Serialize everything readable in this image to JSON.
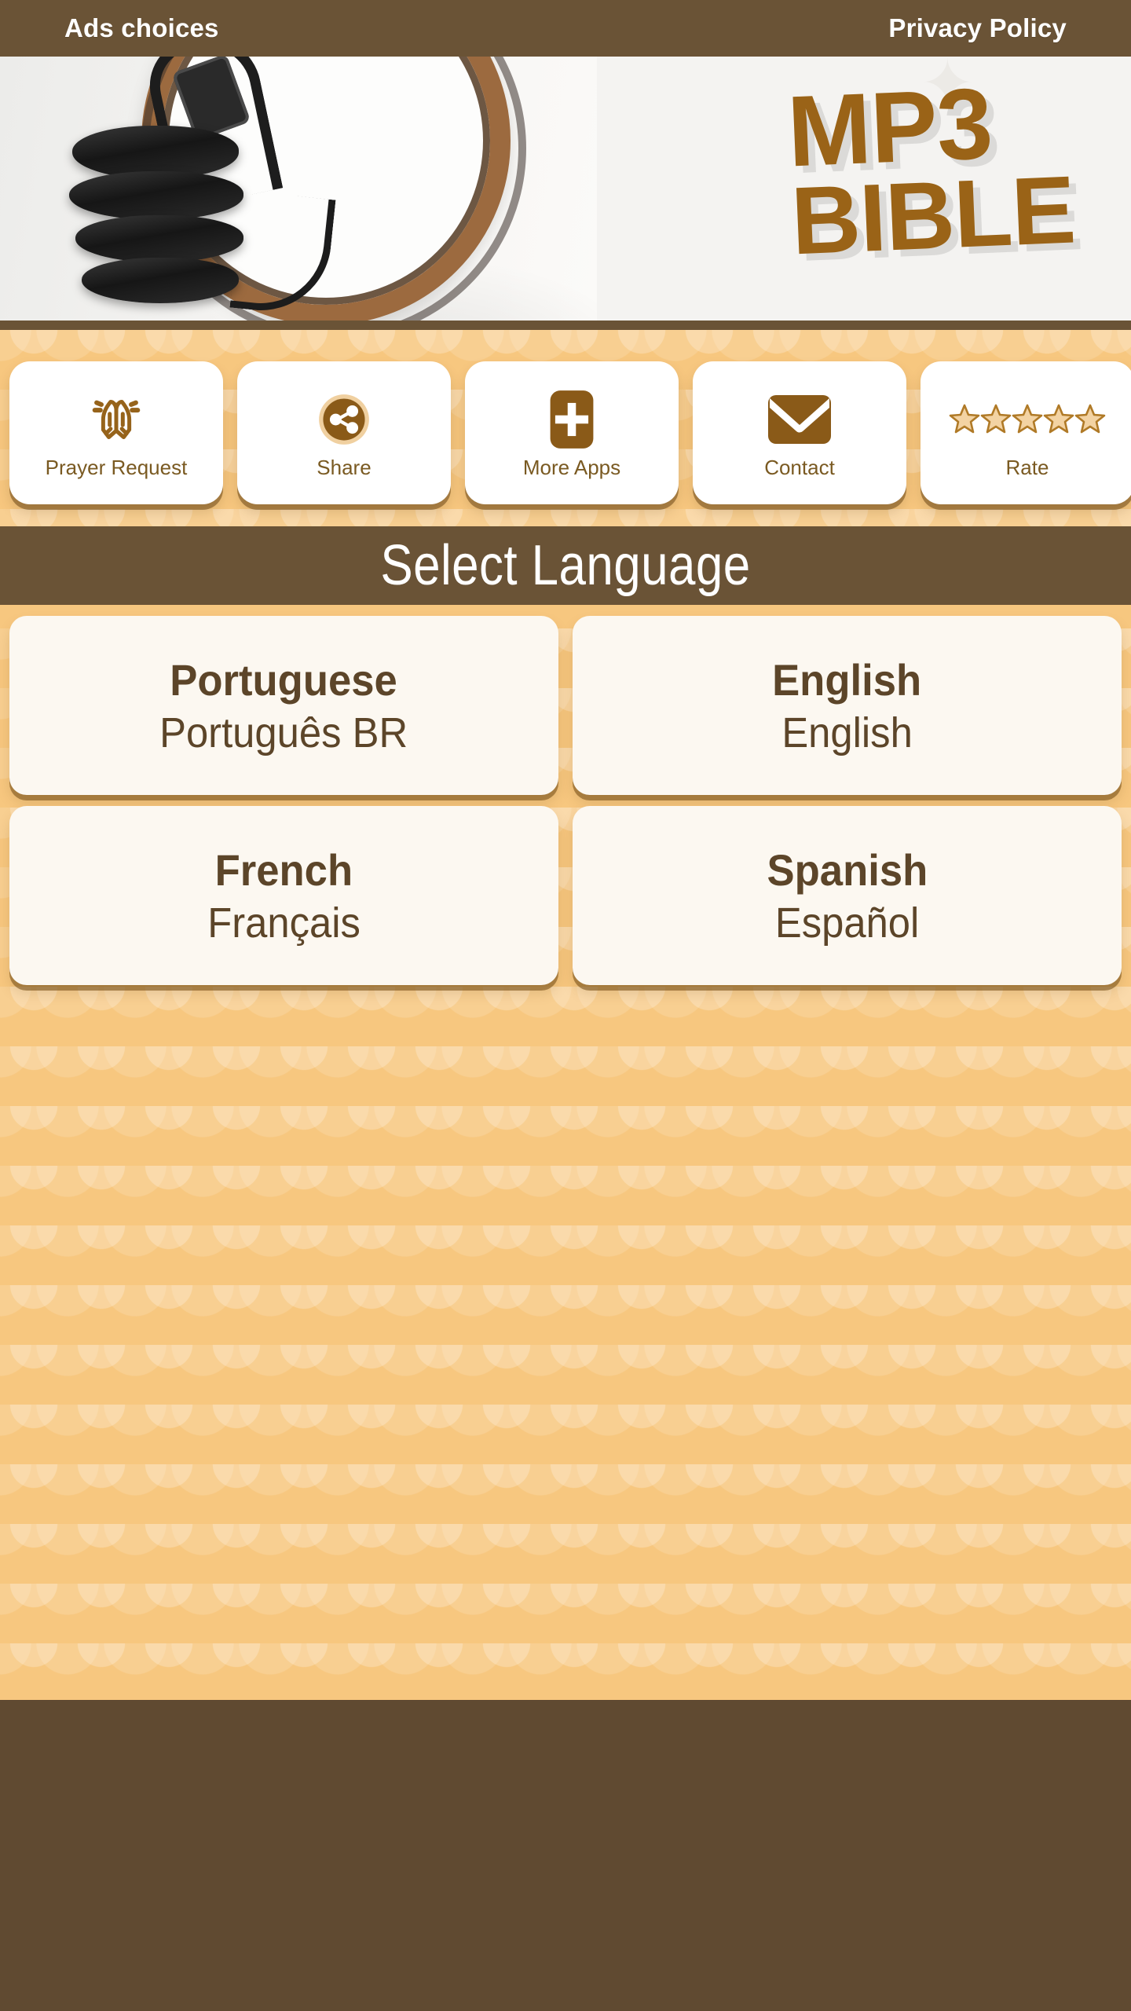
{
  "adbar": {
    "left_link": "Ads choices",
    "right_link": "Privacy Policy"
  },
  "banner": {
    "logo_line1": "MP3",
    "logo_line2": "BIBLE",
    "logo_color": "#9a6317",
    "image_alt": "headphones"
  },
  "toolbar": {
    "items": [
      {
        "label": "Prayer Request",
        "icon": "praying-hands-icon"
      },
      {
        "label": "Share",
        "icon": "share-icon"
      },
      {
        "label": "More Apps",
        "icon": "plus-icon"
      },
      {
        "label": "Contact",
        "icon": "envelope-icon"
      },
      {
        "label": "Rate",
        "icon": "stars-icon",
        "stars": "★★★★★"
      }
    ]
  },
  "section": {
    "title": "Select Language"
  },
  "languages": [
    {
      "name": "Portuguese",
      "native": "Português BR"
    },
    {
      "name": "English",
      "native": "English"
    },
    {
      "name": "French",
      "native": "Français"
    },
    {
      "name": "Spanish",
      "native": "Español"
    }
  ],
  "theme": {
    "brown_dark": "#604a31",
    "brown_bar": "#6a5336",
    "orange_bg": "#f7c77f",
    "card_cream": "#fcf8f1",
    "accent_gold": "#9a6317"
  }
}
